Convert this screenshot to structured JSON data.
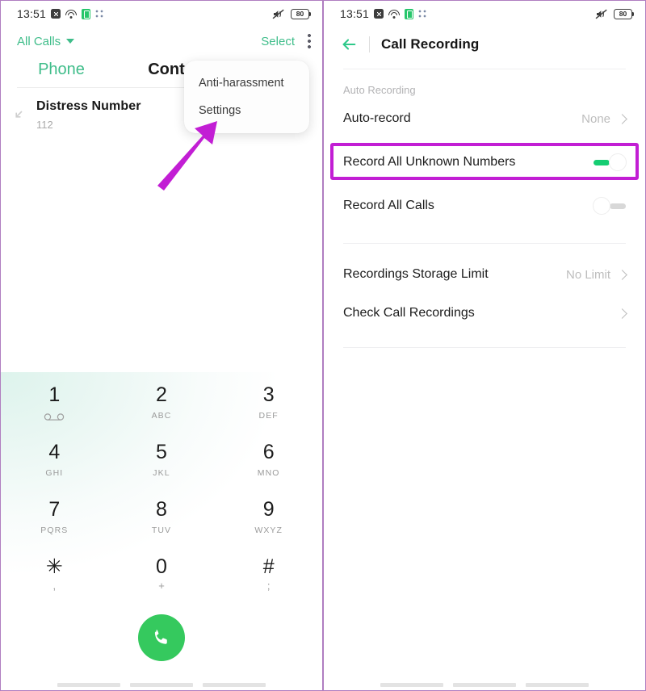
{
  "status_bar": {
    "time": "13:51",
    "battery_level": "80",
    "icons": [
      "alarm-icon",
      "wifi-icon",
      "sim-card-icon",
      "app-dots-icon",
      "mute-vibrate-icon",
      "battery-icon"
    ]
  },
  "colors": {
    "accent_green": "#3fbd8a",
    "toggle_on_green": "#15cd72",
    "call_button_green": "#35c95e",
    "highlight_magenta": "#c21ed4",
    "arrow_magenta": "#c21ed4",
    "panel_border": "#b07ec0",
    "muted_text": "#bdbdbd"
  },
  "left_panel": {
    "app_bar": {
      "filter_label": "All Calls",
      "select_label": "Select",
      "overflow_label": "More options"
    },
    "tabs": [
      {
        "label": "Phone",
        "active": true
      },
      {
        "label": "Contacts",
        "active": false
      }
    ],
    "call_list": [
      {
        "name": "Distress Number",
        "number": "112"
      }
    ],
    "popup_menu": {
      "items": [
        {
          "label": "Anti-harassment"
        },
        {
          "label": "Settings"
        }
      ]
    },
    "keypad": {
      "keys": [
        {
          "num": "1",
          "sub": "",
          "icon": "voicemail-icon"
        },
        {
          "num": "2",
          "sub": "ABC",
          "icon": ""
        },
        {
          "num": "3",
          "sub": "DEF",
          "icon": ""
        },
        {
          "num": "4",
          "sub": "GHI",
          "icon": ""
        },
        {
          "num": "5",
          "sub": "JKL",
          "icon": ""
        },
        {
          "num": "6",
          "sub": "MNO",
          "icon": ""
        },
        {
          "num": "7",
          "sub": "PQRS",
          "icon": ""
        },
        {
          "num": "8",
          "sub": "TUV",
          "icon": ""
        },
        {
          "num": "9",
          "sub": "WXYZ",
          "icon": ""
        },
        {
          "num": "✳",
          "sub": ",",
          "icon": ""
        },
        {
          "num": "0",
          "sub": "+",
          "icon": ""
        },
        {
          "num": "#",
          "sub": ";",
          "icon": ""
        }
      ],
      "call_button": "call-button"
    }
  },
  "right_panel": {
    "title_bar": {
      "back_label": "Back",
      "title": "Call Recording"
    },
    "section_label": "Auto Recording",
    "rows": [
      {
        "label": "Auto-record",
        "value": "None",
        "control": "chevron"
      },
      {
        "label": "Record All Unknown Numbers",
        "value": "",
        "control": "toggle-on",
        "highlighted": true
      },
      {
        "label": "Record All Calls",
        "value": "",
        "control": "toggle-off"
      },
      {
        "label": "Recordings Storage Limit",
        "value": "No Limit",
        "control": "chevron"
      },
      {
        "label": "Check Call Recordings",
        "value": "",
        "control": "chevron"
      }
    ]
  }
}
